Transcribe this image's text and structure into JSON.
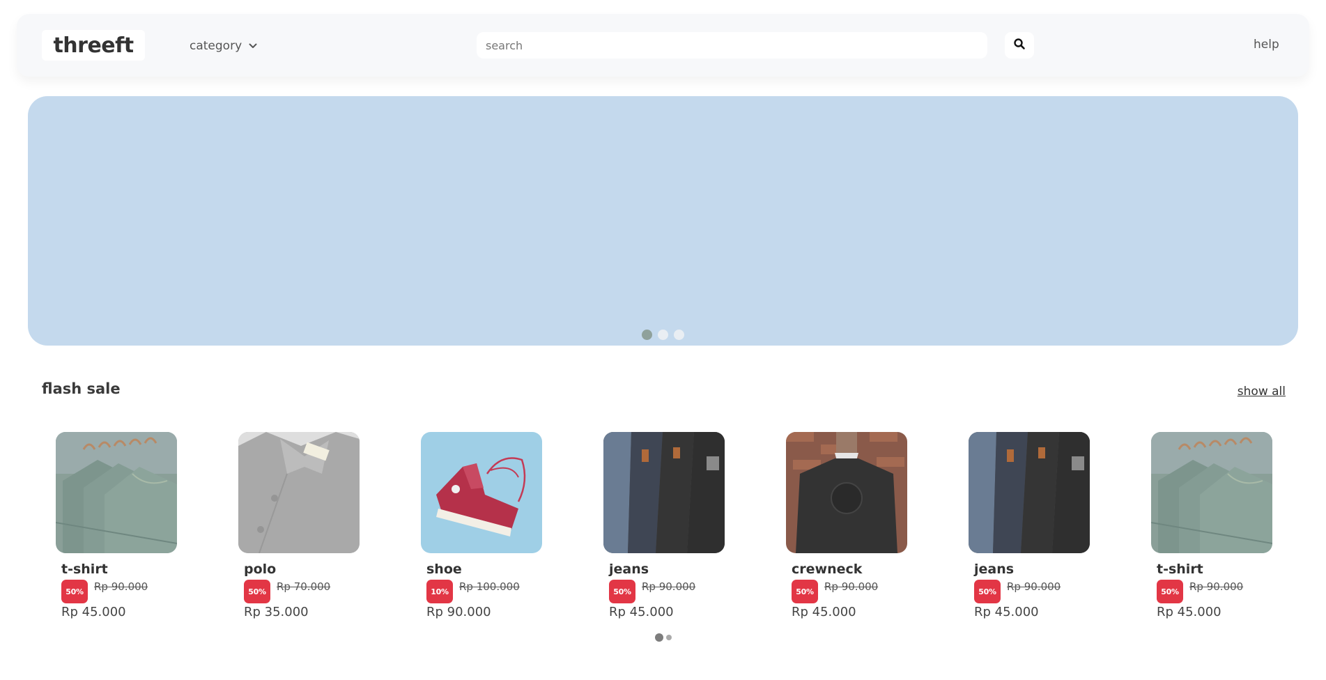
{
  "header": {
    "logo": "threeft",
    "category_label": "category",
    "search_placeholder": "search",
    "help_label": "help"
  },
  "banner": {
    "slides": 3,
    "active_slide": 1,
    "background_color": "#c4d9ed"
  },
  "flash_sale": {
    "title": "flash sale",
    "show_all_label": "show all",
    "products": [
      {
        "name": "t-shirt",
        "discount": "50%",
        "old_price": "Rp 90.000",
        "price": "Rp 45.000",
        "image": "green-tshirts-on-hangers"
      },
      {
        "name": "polo",
        "discount": "50%",
        "old_price": "Rp 70.000",
        "price": "Rp 35.000",
        "image": "grey-polo-collar"
      },
      {
        "name": "shoe",
        "discount": "10%",
        "old_price": "Rp 100.000",
        "price": "Rp 90.000",
        "image": "red-hightop-sneaker"
      },
      {
        "name": "jeans",
        "discount": "50%",
        "old_price": "Rp 90.000",
        "price": "Rp 45.000",
        "image": "stacked-jeans"
      },
      {
        "name": "crewneck",
        "discount": "50%",
        "old_price": "Rp 90.000",
        "price": "Rp 45.000",
        "image": "black-crewneck-sweater"
      },
      {
        "name": "jeans",
        "discount": "50%",
        "old_price": "Rp 90.000",
        "price": "Rp 45.000",
        "image": "stacked-jeans"
      },
      {
        "name": "t-shirt",
        "discount": "50%",
        "old_price": "Rp 90.000",
        "price": "Rp 45.000",
        "image": "green-tshirts-on-hangers"
      }
    ],
    "pages": 2,
    "active_page": 1
  },
  "colors": {
    "badge": "#e23645",
    "header_bg": "#f7f8fa"
  }
}
